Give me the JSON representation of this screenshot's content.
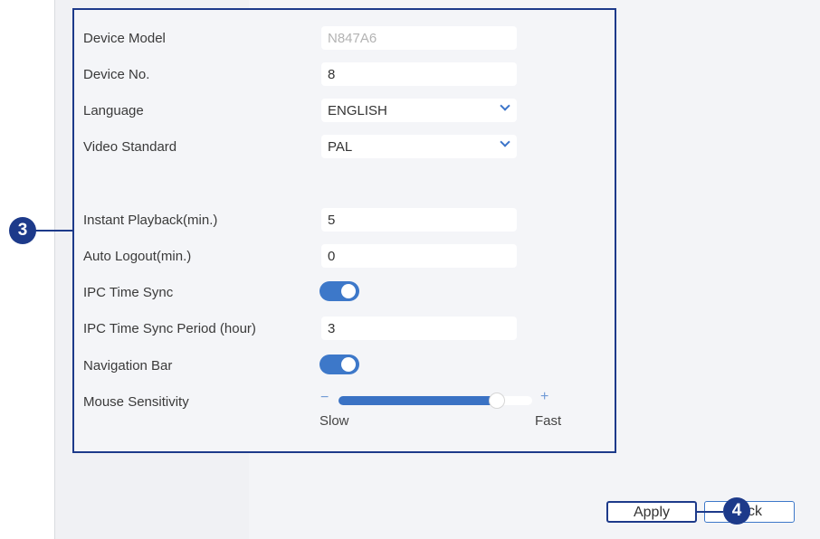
{
  "settings": {
    "device_model": {
      "label": "Device Model",
      "value": "N847A6"
    },
    "device_no": {
      "label": "Device No.",
      "value": "8"
    },
    "language": {
      "label": "Language",
      "value": "ENGLISH"
    },
    "video_standard": {
      "label": "Video Standard",
      "value": "PAL"
    },
    "instant_playback": {
      "label": "Instant Playback(min.)",
      "value": "5"
    },
    "auto_logout": {
      "label": "Auto Logout(min.)",
      "value": "0"
    },
    "ipc_time_sync": {
      "label": "IPC Time Sync",
      "enabled": true
    },
    "ipc_time_sync_period": {
      "label": "IPC Time Sync Period (hour)",
      "value": "3"
    },
    "navigation_bar": {
      "label": "Navigation Bar",
      "enabled": true
    },
    "mouse_sensitivity": {
      "label": "Mouse Sensitivity",
      "minus_symbol": "−",
      "plus_symbol": "+",
      "min_caption": "Slow",
      "max_caption": "Fast",
      "level_fraction": 0.82
    }
  },
  "buttons": {
    "apply": "Apply",
    "back": "ck"
  },
  "callouts": {
    "settings_marker": "3",
    "apply_marker": "4"
  },
  "colors": {
    "accent": "#3d78c9",
    "callout": "#1d3a8a"
  },
  "icons": {
    "dropdown": "chevron-down-icon"
  }
}
